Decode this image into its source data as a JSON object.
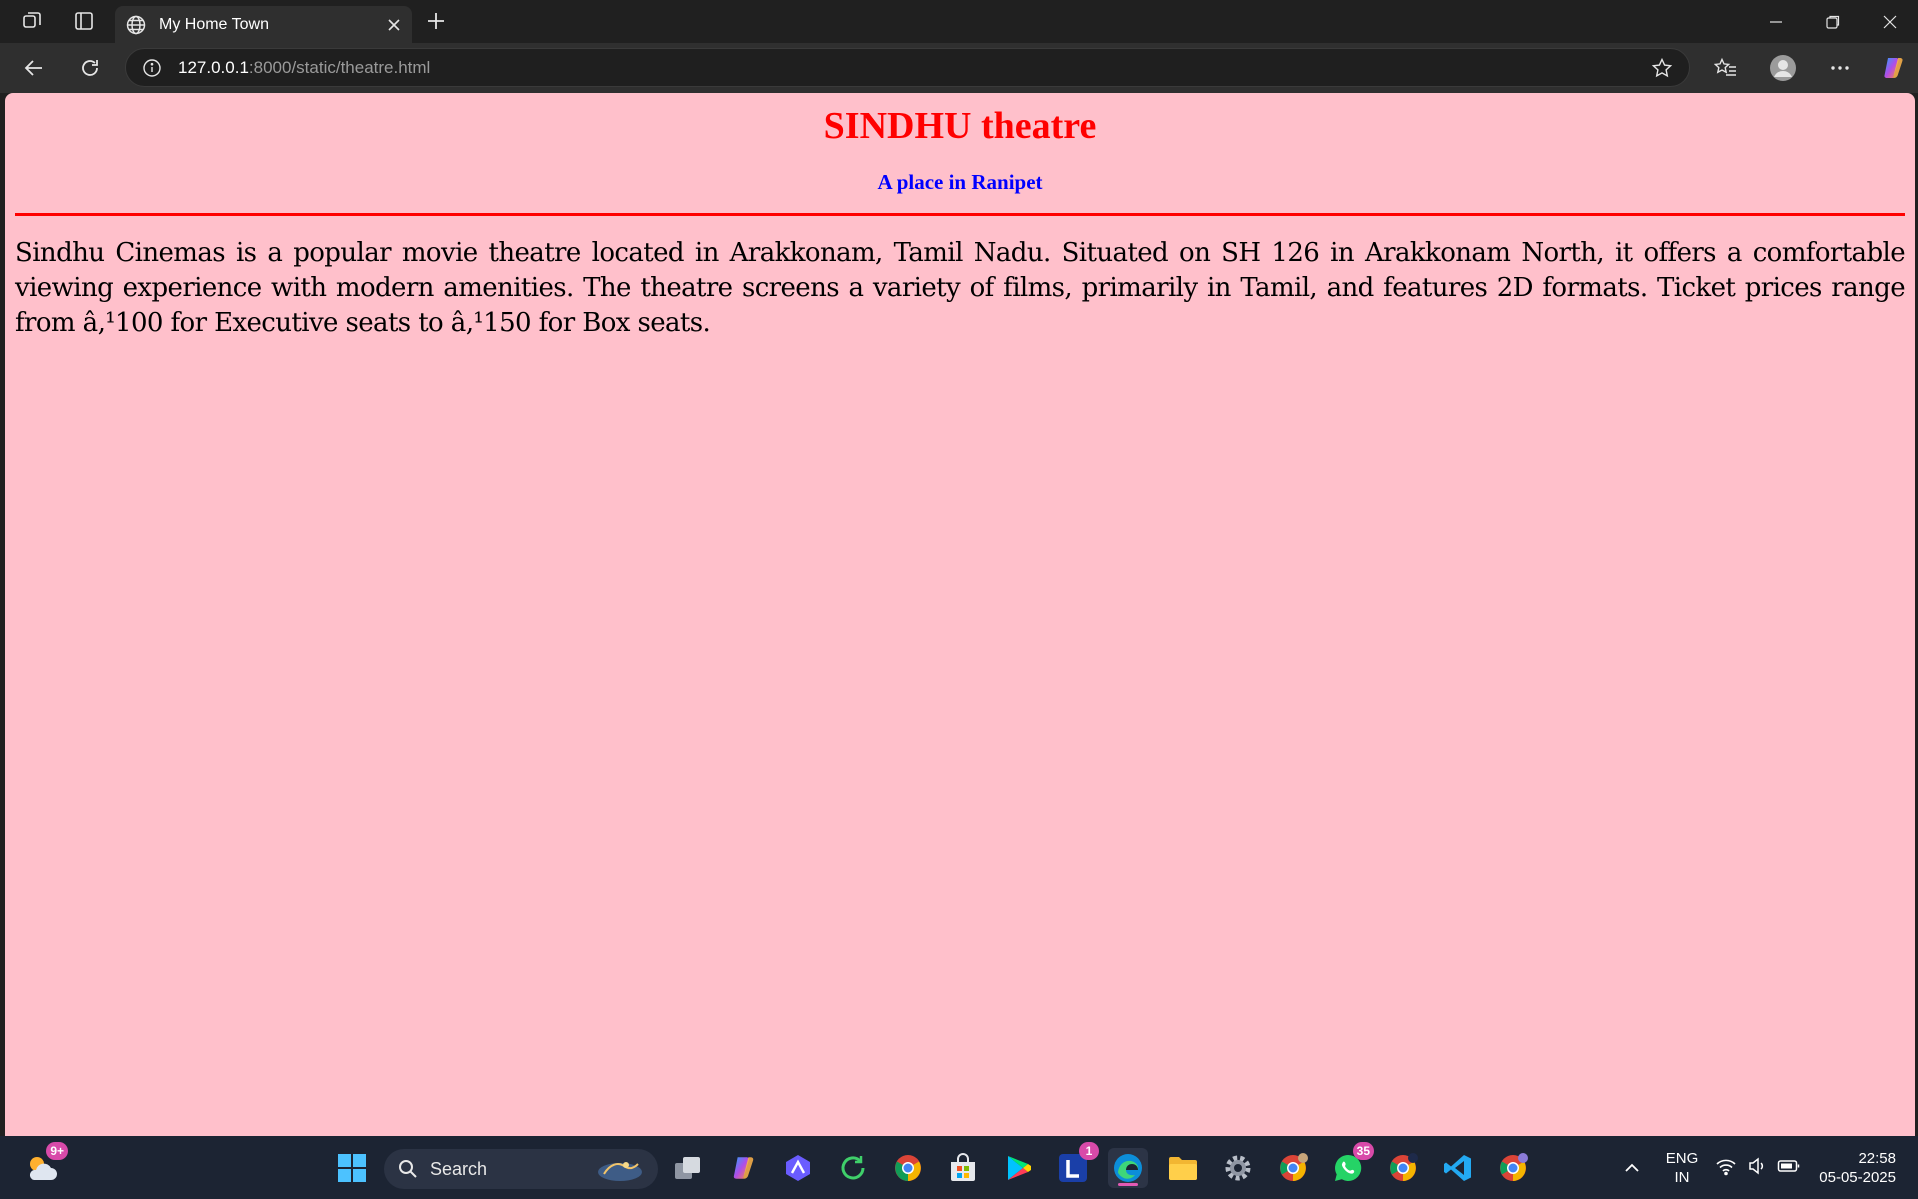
{
  "browser": {
    "tab_title": "My Home Town",
    "url_host": "127.0.0.1",
    "url_path": ":8000/static/theatre.html"
  },
  "page": {
    "title": "SINDHU theatre",
    "subtitle": "A place in Ranipet",
    "body": "Sindhu Cinemas is a popular movie theatre located in Arakkonam, Tamil Nadu. Situated on SH 126 in Arakkonam North, it offers a comfortable viewing experience with modern amenities. The theatre screens a variety of films, primarily in Tamil, and features 2D formats. Ticket prices range from â‚¹100 for Executive seats to â‚¹150 for Box seats.",
    "background_color": "#ffc0cb",
    "title_color": "#ff0000",
    "subtitle_color": "#0000ff"
  },
  "taskbar": {
    "search_label": "Search",
    "weather_badge": "9+",
    "l_app_badge": "1",
    "whatsapp_badge": "35",
    "language_line1": "ENG",
    "language_line2": "IN",
    "time": "22:58",
    "date": "05-05-2025"
  }
}
